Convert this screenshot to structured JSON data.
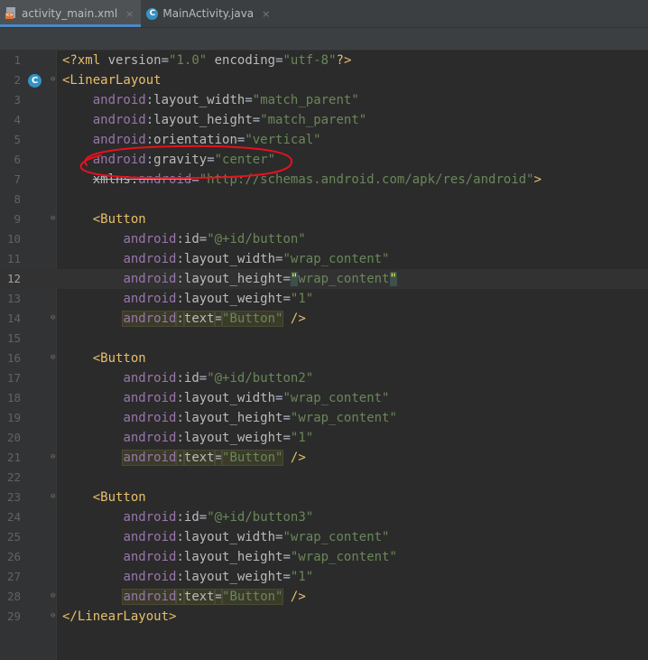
{
  "tabs": [
    {
      "label": "activity_main.xml",
      "icon": "xml-file-icon",
      "active": true
    },
    {
      "label": "MainActivity.java",
      "icon": "java-class-icon",
      "active": false
    }
  ],
  "tab_close_glyph": "×",
  "class_badge": "C",
  "xml_badge": "<>",
  "fold_glyph": "⊖",
  "colors": {
    "background": "#2b2b2b",
    "tag": "#e8bf6a",
    "namespace": "#9876aa",
    "attribute": "#bababa",
    "value": "#6a8759",
    "annotation": "#e8111d"
  },
  "editor": {
    "current_line": 12,
    "lines": [
      {
        "n": "1",
        "parts": [
          [
            "tag",
            "<?xml "
          ],
          [
            "attr",
            "version"
          ],
          [
            "txt",
            "="
          ],
          [
            "val",
            "\"1.0\""
          ],
          [
            "txt",
            " "
          ],
          [
            "attr",
            "encoding"
          ],
          [
            "txt",
            "="
          ],
          [
            "val",
            "\"utf-8\""
          ],
          [
            "tag",
            "?>"
          ]
        ]
      },
      {
        "n": "2",
        "parts": [
          [
            "tag",
            "<LinearLayout"
          ]
        ]
      },
      {
        "n": "3",
        "parts": [
          [
            "txt",
            "    "
          ],
          [
            "ns",
            "android"
          ],
          [
            "txt",
            ":"
          ],
          [
            "attr",
            "layout_width"
          ],
          [
            "txt",
            "="
          ],
          [
            "val",
            "\"match_parent\""
          ]
        ]
      },
      {
        "n": "4",
        "parts": [
          [
            "txt",
            "    "
          ],
          [
            "ns",
            "android"
          ],
          [
            "txt",
            ":"
          ],
          [
            "attr",
            "layout_height"
          ],
          [
            "txt",
            "="
          ],
          [
            "val",
            "\"match_parent\""
          ]
        ]
      },
      {
        "n": "5",
        "parts": [
          [
            "txt",
            "    "
          ],
          [
            "ns",
            "android"
          ],
          [
            "txt",
            ":"
          ],
          [
            "attr",
            "orientation"
          ],
          [
            "txt",
            "="
          ],
          [
            "val",
            "\"vertical\""
          ]
        ]
      },
      {
        "n": "6",
        "parts": [
          [
            "txt",
            "    "
          ],
          [
            "ns",
            "android"
          ],
          [
            "txt",
            ":"
          ],
          [
            "attr",
            "gravity"
          ],
          [
            "txt",
            "="
          ],
          [
            "val",
            "\"center\""
          ]
        ]
      },
      {
        "n": "7",
        "parts": [
          [
            "txt",
            "    "
          ],
          [
            "attr",
            "xmlns:"
          ],
          [
            "ns",
            "android"
          ],
          [
            "txt",
            "="
          ],
          [
            "val",
            "\"http://schemas.android.com/apk/res/android\""
          ],
          [
            "tag",
            ">"
          ]
        ]
      },
      {
        "n": "8",
        "parts": []
      },
      {
        "n": "9",
        "parts": [
          [
            "txt",
            "    "
          ],
          [
            "tag",
            "<Button"
          ]
        ]
      },
      {
        "n": "10",
        "parts": [
          [
            "txt",
            "        "
          ],
          [
            "ns",
            "android"
          ],
          [
            "txt",
            ":"
          ],
          [
            "attr",
            "id"
          ],
          [
            "txt",
            "="
          ],
          [
            "val",
            "\"@+id/button\""
          ]
        ]
      },
      {
        "n": "11",
        "parts": [
          [
            "txt",
            "        "
          ],
          [
            "ns",
            "android"
          ],
          [
            "txt",
            ":"
          ],
          [
            "attr",
            "layout_width"
          ],
          [
            "txt",
            "="
          ],
          [
            "val",
            "\"wrap_content\""
          ]
        ]
      },
      {
        "n": "12",
        "parts": [
          [
            "txt",
            "        "
          ],
          [
            "ns",
            "android"
          ],
          [
            "txt",
            ":"
          ],
          [
            "attr",
            "layout_height"
          ],
          [
            "txt",
            "="
          ],
          [
            "brace",
            "\""
          ],
          [
            "val",
            "wrap_content"
          ],
          [
            "brace",
            "\""
          ]
        ]
      },
      {
        "n": "13",
        "parts": [
          [
            "txt",
            "        "
          ],
          [
            "ns",
            "android"
          ],
          [
            "txt",
            ":"
          ],
          [
            "attr",
            "layout_weight"
          ],
          [
            "txt",
            "="
          ],
          [
            "val",
            "\"1\""
          ]
        ]
      },
      {
        "n": "14",
        "parts": [
          [
            "txt",
            "        "
          ],
          [
            "nshl",
            "android"
          ],
          [
            "hl",
            ":"
          ],
          [
            "hlattr",
            "text"
          ],
          [
            "hl",
            "="
          ],
          [
            "hlval",
            "\"Button\""
          ],
          [
            "txt",
            " "
          ],
          [
            "tag",
            "/>"
          ]
        ]
      },
      {
        "n": "15",
        "parts": []
      },
      {
        "n": "16",
        "parts": [
          [
            "txt",
            "    "
          ],
          [
            "tag",
            "<Button"
          ]
        ]
      },
      {
        "n": "17",
        "parts": [
          [
            "txt",
            "        "
          ],
          [
            "ns",
            "android"
          ],
          [
            "txt",
            ":"
          ],
          [
            "attr",
            "id"
          ],
          [
            "txt",
            "="
          ],
          [
            "val",
            "\"@+id/button2\""
          ]
        ]
      },
      {
        "n": "18",
        "parts": [
          [
            "txt",
            "        "
          ],
          [
            "ns",
            "android"
          ],
          [
            "txt",
            ":"
          ],
          [
            "attr",
            "layout_width"
          ],
          [
            "txt",
            "="
          ],
          [
            "val",
            "\"wrap_content\""
          ]
        ]
      },
      {
        "n": "19",
        "parts": [
          [
            "txt",
            "        "
          ],
          [
            "ns",
            "android"
          ],
          [
            "txt",
            ":"
          ],
          [
            "attr",
            "layout_height"
          ],
          [
            "txt",
            "="
          ],
          [
            "val",
            "\"wrap_content\""
          ]
        ]
      },
      {
        "n": "20",
        "parts": [
          [
            "txt",
            "        "
          ],
          [
            "ns",
            "android"
          ],
          [
            "txt",
            ":"
          ],
          [
            "attr",
            "layout_weight"
          ],
          [
            "txt",
            "="
          ],
          [
            "val",
            "\"1\""
          ]
        ]
      },
      {
        "n": "21",
        "parts": [
          [
            "txt",
            "        "
          ],
          [
            "nshl",
            "android"
          ],
          [
            "hl",
            ":"
          ],
          [
            "hlattr",
            "text"
          ],
          [
            "hl",
            "="
          ],
          [
            "hlval",
            "\"Button\""
          ],
          [
            "txt",
            " "
          ],
          [
            "tag",
            "/>"
          ]
        ]
      },
      {
        "n": "22",
        "parts": []
      },
      {
        "n": "23",
        "parts": [
          [
            "txt",
            "    "
          ],
          [
            "tag",
            "<Button"
          ]
        ]
      },
      {
        "n": "24",
        "parts": [
          [
            "txt",
            "        "
          ],
          [
            "ns",
            "android"
          ],
          [
            "txt",
            ":"
          ],
          [
            "attr",
            "id"
          ],
          [
            "txt",
            "="
          ],
          [
            "val",
            "\"@+id/button3\""
          ]
        ]
      },
      {
        "n": "25",
        "parts": [
          [
            "txt",
            "        "
          ],
          [
            "ns",
            "android"
          ],
          [
            "txt",
            ":"
          ],
          [
            "attr",
            "layout_width"
          ],
          [
            "txt",
            "="
          ],
          [
            "val",
            "\"wrap_content\""
          ]
        ]
      },
      {
        "n": "26",
        "parts": [
          [
            "txt",
            "        "
          ],
          [
            "ns",
            "android"
          ],
          [
            "txt",
            ":"
          ],
          [
            "attr",
            "layout_height"
          ],
          [
            "txt",
            "="
          ],
          [
            "val",
            "\"wrap_content\""
          ]
        ]
      },
      {
        "n": "27",
        "parts": [
          [
            "txt",
            "        "
          ],
          [
            "ns",
            "android"
          ],
          [
            "txt",
            ":"
          ],
          [
            "attr",
            "layout_weight"
          ],
          [
            "txt",
            "="
          ],
          [
            "val",
            "\"1\""
          ]
        ]
      },
      {
        "n": "28",
        "parts": [
          [
            "txt",
            "        "
          ],
          [
            "nshl",
            "android"
          ],
          [
            "hl",
            ":"
          ],
          [
            "hlattr",
            "text"
          ],
          [
            "hl",
            "="
          ],
          [
            "hlval",
            "\"Button\""
          ],
          [
            "txt",
            " "
          ],
          [
            "tag",
            "/>"
          ]
        ]
      },
      {
        "n": "29",
        "parts": [
          [
            "tag",
            "</LinearLayout>"
          ]
        ]
      }
    ]
  },
  "annotation": {
    "shape": "hand-drawn-ellipse",
    "target_line": 6,
    "color": "#e8111d"
  }
}
